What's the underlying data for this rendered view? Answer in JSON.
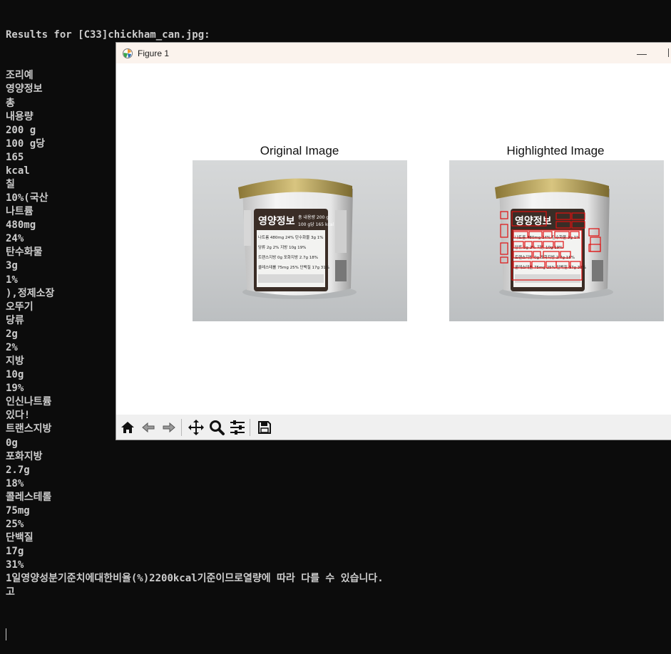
{
  "terminal": {
    "header_line": "Results for [C33]chickham_can.jpg:",
    "lines": [
      "조리예",
      "영양정보",
      "총",
      "내용량",
      "200 g",
      "100 g당",
      "165",
      "kcal",
      "칠",
      "10%(국산",
      "나트륨",
      "480mg",
      "24%",
      "탄수화물",
      "3g",
      "1%",
      "),정제소장",
      "오뚜기",
      "당류",
      "2g",
      "2%",
      "지방",
      "10g",
      "19%",
      "인신나트륨",
      "있다!",
      "트랜스지방",
      "0g",
      "포화지방",
      "2.7g",
      "18%",
      "콜레스테롤",
      "75mg",
      "25%",
      "단백질",
      "17g",
      "31%",
      "1일영양성분기준치에대한비율(%)2200kcal기준이므로열량에 따라 다를 수 있습니다.",
      "고"
    ]
  },
  "figure": {
    "window_title": "Figure 1",
    "minimize_label": "—",
    "subplots": [
      {
        "title": "Original Image"
      },
      {
        "title": "Highlighted Image"
      }
    ],
    "can_label": {
      "title": "영양정보",
      "total": "총 내용량 200 g",
      "per": "100 g당 165 kcal",
      "rows": [
        "나트륨 480mg 24%  탄수화물 3g 1%",
        "당류 2g 2%  지방 10g 19%",
        "트랜스지방 0g  포화지방 2.7g 18%",
        "콜레스테롤 75mg 25%  단백질 17g 31%"
      ]
    },
    "toolbar_icons": [
      "home-icon",
      "back-icon",
      "forward-icon",
      "pan-icon",
      "zoom-icon",
      "configure-icon",
      "save-icon"
    ],
    "colors": {
      "highlight_box": "#e01010",
      "titlebar": "#fbf3ed",
      "toolbar": "#f0f0f0"
    }
  }
}
